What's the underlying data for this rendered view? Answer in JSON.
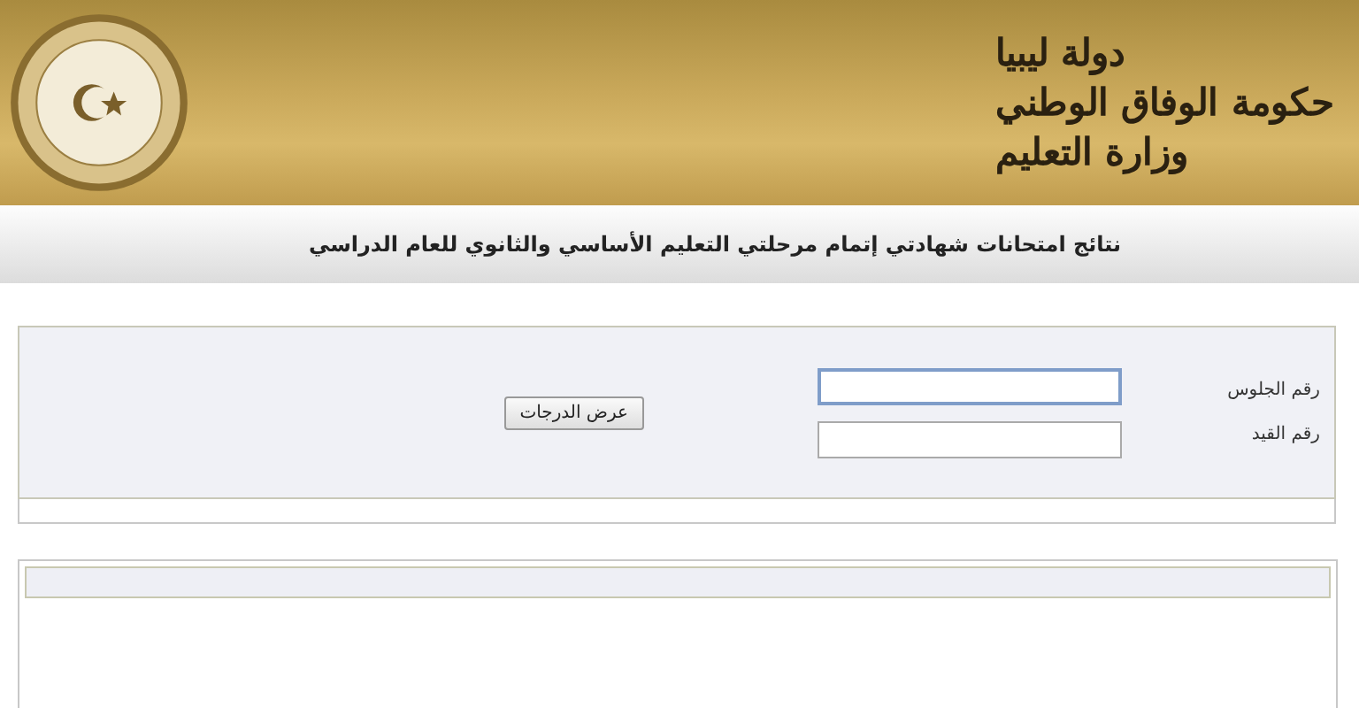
{
  "header": {
    "lines": [
      "دولة ليبيا",
      "حكومة الوفاق الوطني",
      "وزارة التعليم"
    ]
  },
  "title": "نتائج امتحانات شهادتي إتمام مرحلتي التعليم الأساسي والثانوي للعام الدراسي",
  "form": {
    "fields": [
      {
        "label": "رقم الجلوس",
        "focused": true
      },
      {
        "label": "رقم القيد",
        "focused": false
      }
    ],
    "button": "عرض الدرجات"
  }
}
